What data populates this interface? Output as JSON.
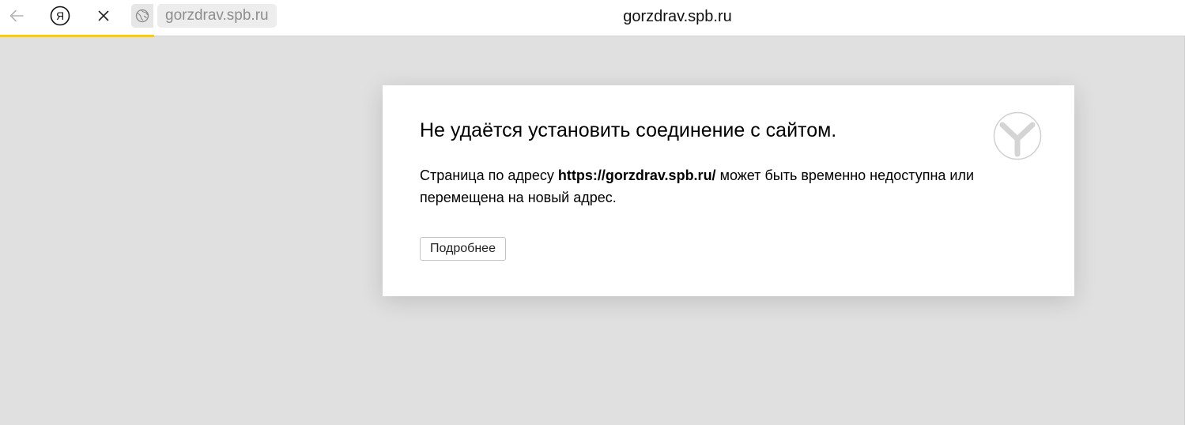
{
  "browser": {
    "address": "gorzdrav.spb.ru",
    "page_title": "gorzdrav.spb.ru",
    "yandex_button_glyph": "Я",
    "loading_progress_percent": 13,
    "icons": {
      "back": "arrow-left-icon",
      "yandex": "yandex-logo-icon",
      "stop": "close-icon",
      "site": "globe-icon"
    },
    "colors": {
      "progress": "#ffcc00",
      "page_background": "#e0e0e0"
    }
  },
  "error": {
    "title": "Не удаётся установить соединение с сайтом.",
    "desc_prefix": "Страница по адресу ",
    "desc_url": "https://gorzdrav.spb.ru/",
    "desc_suffix": " может быть временно недоступна или перемещена на новый адрес.",
    "details_label": "Подробнее",
    "logo_icon": "yandex-browser-logo-icon"
  }
}
